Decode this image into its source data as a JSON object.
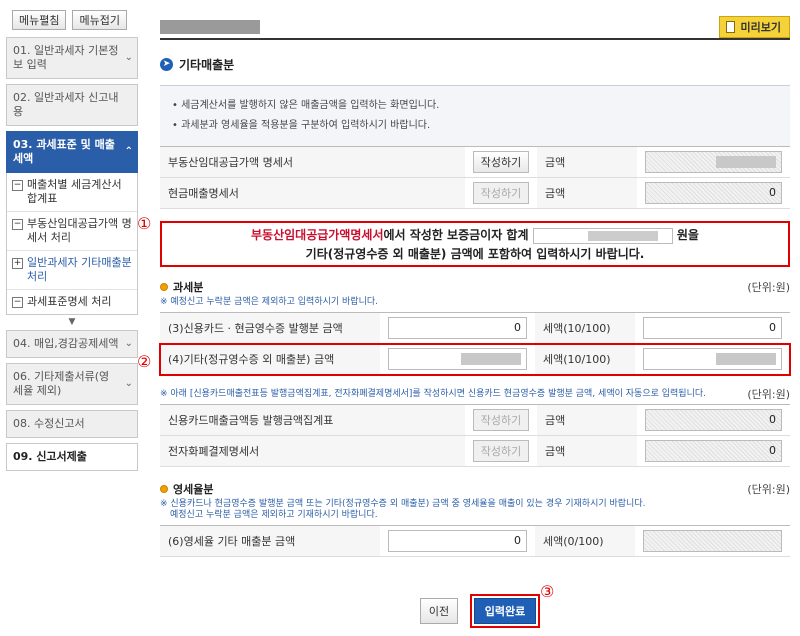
{
  "sidebar": {
    "expand_label": "메뉴펼침",
    "collapse_label": "메뉴접기",
    "items": [
      {
        "label": "01. 일반과세자 기본정보 입력"
      },
      {
        "label": "02. 일반과세자 신고내용"
      },
      {
        "label": "03. 과세표준 및 매출세액"
      },
      {
        "label": "04. 매입,경감공제세액"
      },
      {
        "label": "06. 기타제출서류(영세율 제외)"
      },
      {
        "label": "08. 수정신고서"
      },
      {
        "label": "09. 신고서제출"
      }
    ],
    "subitems": [
      {
        "label": "매출처별 세금계산서 합계표",
        "sym": "−"
      },
      {
        "label": "부동산임대공급가액 명세서 처리",
        "sym": "−"
      },
      {
        "label": "일반과세자 기타매출분 처리",
        "sym": "+"
      },
      {
        "label": "과세표준명세 처리",
        "sym": "−"
      }
    ]
  },
  "header": {
    "preview_label": "미리보기"
  },
  "section": {
    "title": "기타매출분"
  },
  "info": {
    "line1": "• 세금계산서를 발행하지 않은 매출금액을 입력하는 화면입니다.",
    "line2": "• 과세분과 영세율을 적용분을 구분하여 입력하시기 바랍니다."
  },
  "top_rows": [
    {
      "label": "부동산임대공급가액 명세서",
      "button": "작성하기",
      "amount_label": "금액",
      "value": ""
    },
    {
      "label": "현금매출명세서",
      "button": "작성하기",
      "amount_label": "금액",
      "value": "0"
    }
  ],
  "notice": {
    "red_text": "부동산임대공급가액명세서",
    "text1": "에서 작성한 보증금이자 합계",
    "text2": "원을",
    "text3": "기타(정규영수증 외 매출분) 금액에 포함하여 입력하시기 바랍니다."
  },
  "taxable": {
    "title": "과세분",
    "unit": "(단위:원)",
    "note": "※ 예정신고 누락분 금액은 제외하고 입력하시기 바랍니다.",
    "rows": [
      {
        "label": "(3)신용카드 · 현금영수증 발행분 금액",
        "value": "0",
        "tax_label": "세액(10/100)",
        "tax_value": "0"
      },
      {
        "label": "(4)기타(정규영수증 외 매출분) 금액",
        "value": "",
        "tax_label": "세액(10/100)",
        "tax_value": ""
      }
    ],
    "note2": "※ 아래 [신용카드매출전표등 발행금액집계표, 전자화폐결제명세서]를 작성하시면 신용카드 현금영수증 발행분 금액, 세액이 자동으로 입력됩니다.",
    "unit2": "(단위:원)",
    "card_rows": [
      {
        "label": "신용카드매출금액등 발행금액집계표",
        "button": "작성하기",
        "amount_label": "금액",
        "value": "0"
      },
      {
        "label": "전자화폐결제명세서",
        "button": "작성하기",
        "amount_label": "금액",
        "value": "0"
      }
    ]
  },
  "zero_rate": {
    "title": "영세율분",
    "unit": "(단위:원)",
    "note_line1": "※ 신용카드나 현금영수증 발행분 금액 또는 기타(정규영수증 외 매출분) 금액 중 영세율을 매출이 있는 경우 기재하시기 바랍니다.",
    "note_line2": "예정신고 누락분 금액은 제외하고 기재하시기 바랍니다.",
    "row": {
      "label": "(6)영세율 기타 매출분 금액",
      "value": "0",
      "tax_label": "세액(0/100)",
      "tax_value": ""
    }
  },
  "markers": {
    "m1": "①",
    "m2": "②",
    "m3": "③"
  },
  "buttons": {
    "prev": "이전",
    "done": "입력완료"
  }
}
